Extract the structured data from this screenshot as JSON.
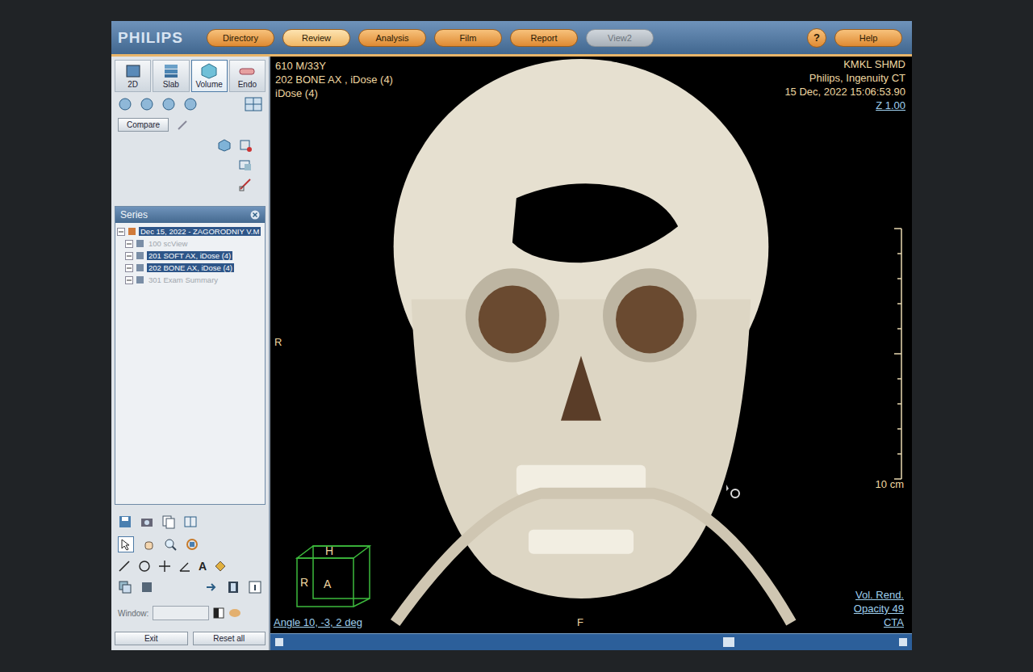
{
  "app": {
    "logo": "PHILIPS"
  },
  "nav_tabs": [
    {
      "label": "Directory",
      "selected": false,
      "disabled": false
    },
    {
      "label": "Review",
      "selected": true,
      "disabled": false
    },
    {
      "label": "Analysis",
      "selected": false,
      "disabled": false
    },
    {
      "label": "Film",
      "selected": false,
      "disabled": false
    },
    {
      "label": "Report",
      "selected": false,
      "disabled": false
    },
    {
      "label": "View2",
      "selected": false,
      "disabled": true
    }
  ],
  "help": {
    "icon": "?",
    "label": "Help"
  },
  "view_modes": [
    {
      "label": "2D",
      "selected": false
    },
    {
      "label": "Slab",
      "selected": false
    },
    {
      "label": "Volume",
      "selected": true
    },
    {
      "label": "Endo",
      "selected": false
    }
  ],
  "compare_button": "Compare",
  "series_panel": {
    "title": "Series",
    "items": [
      {
        "label": "Dec 15, 2022 - ZAGORODNIY V.M",
        "level": 0,
        "selected": true,
        "disabled": false
      },
      {
        "label": "100 scView",
        "level": 1,
        "selected": false,
        "disabled": true
      },
      {
        "label": "201 SOFT AX, iDose (4)",
        "level": 1,
        "selected": true,
        "disabled": false
      },
      {
        "label": "202 BONE AX, iDose (4)",
        "level": 1,
        "selected": true,
        "disabled": false
      },
      {
        "label": "301 Exam Summary",
        "level": 1,
        "selected": false,
        "disabled": true
      }
    ]
  },
  "tools": {
    "text_tool": "A"
  },
  "window_field": {
    "label": "Window:",
    "value": ""
  },
  "footer_buttons": [
    "Exit",
    "Reset all"
  ],
  "viewport": {
    "top_left": [
      "610 M/33Y",
      "202 BONE AX , iDose (4)",
      "iDose (4)"
    ],
    "top_right": [
      "KMKL SHMD",
      "Philips, Ingenuity CT",
      "15 Dec, 2022 15:06:53.90"
    ],
    "zoom": "Z 1.00",
    "left_marker": "R",
    "bottom_marker": "F",
    "cube": {
      "top": "H",
      "left": "R",
      "front": "A"
    },
    "angle": "Angle 10, -3, 2 deg",
    "bottom_right": [
      "Vol. Rend.",
      "Opacity 49",
      "CTA"
    ],
    "ruler": "10 cm"
  }
}
